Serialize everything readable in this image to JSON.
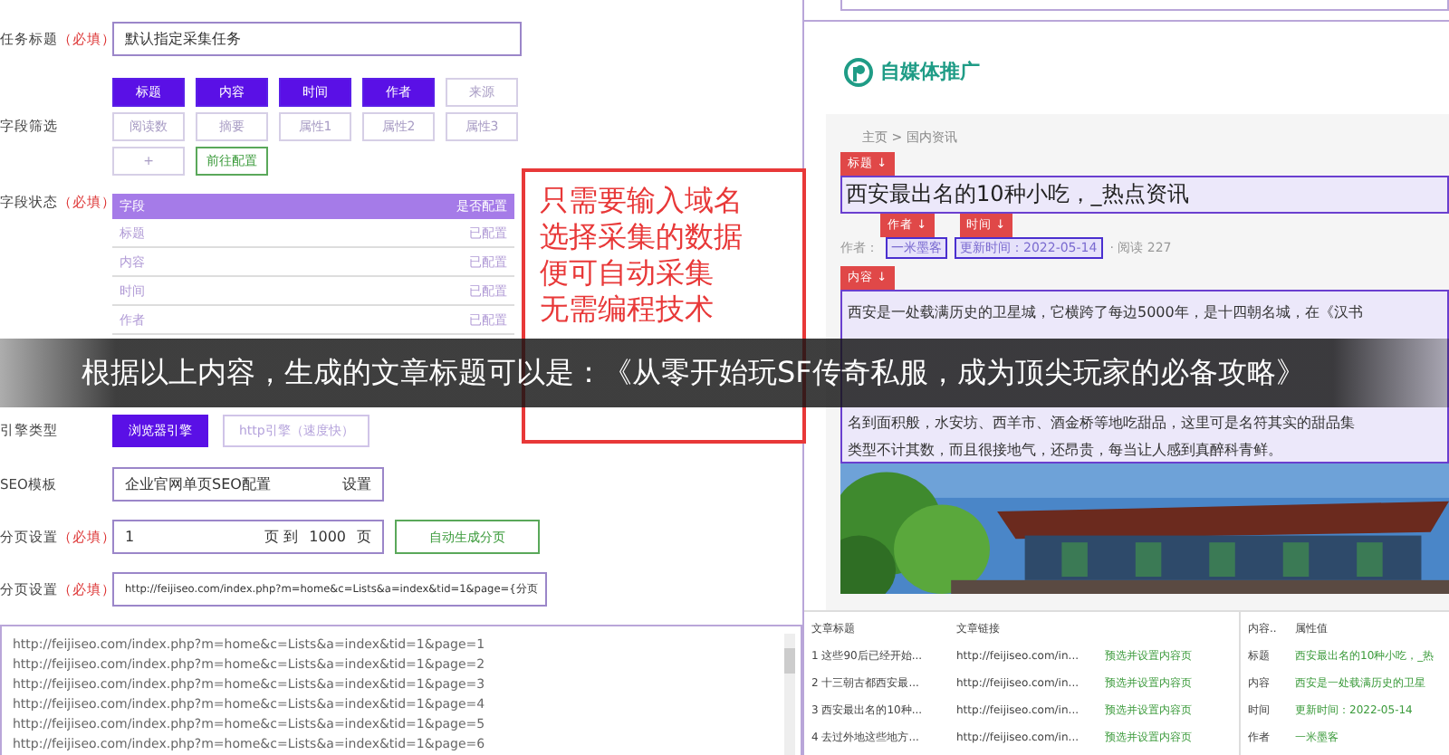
{
  "task": {
    "label": "任务标题",
    "required": "（必填）",
    "value": "默认指定采集任务"
  },
  "fields": {
    "label": "字段筛选",
    "options": [
      {
        "label": "标题",
        "selected": true
      },
      {
        "label": "内容",
        "selected": true
      },
      {
        "label": "时间",
        "selected": true
      },
      {
        "label": "作者",
        "selected": true
      },
      {
        "label": "来源",
        "selected": false
      },
      {
        "label": "阅读数",
        "selected": false
      },
      {
        "label": "摘要",
        "selected": false
      },
      {
        "label": "属性1",
        "selected": false
      },
      {
        "label": "属性2",
        "selected": false
      },
      {
        "label": "属性3",
        "selected": false
      }
    ],
    "add": "+",
    "configure": "前往配置"
  },
  "field_status": {
    "label": "字段状态",
    "required": "（必填）",
    "columns": [
      "字段",
      "是否配置"
    ],
    "rows": [
      {
        "field": "标题",
        "status": "已配置"
      },
      {
        "field": "内容",
        "status": "已配置"
      },
      {
        "field": "时间",
        "status": "已配置"
      },
      {
        "field": "作者",
        "status": "已配置"
      }
    ]
  },
  "engine": {
    "label": "引擎类型",
    "options": [
      {
        "label": "浏览器引擎",
        "selected": true
      },
      {
        "label": "http引擎（速度快）",
        "selected": false
      }
    ]
  },
  "seo": {
    "label": "SEO模板",
    "value": "企业官网单页SEO配置",
    "action": "设置"
  },
  "pagination": {
    "label": "分页设置",
    "required": "（必填）",
    "from": "1",
    "unit_from": "页 到",
    "to": "1000",
    "unit_to": "页",
    "generate": "自动生成分页"
  },
  "pagination_url": {
    "label": "分页设置",
    "required": "（必填）",
    "value": "http://feijiseo.com/index.php?m=home&c=Lists&a=index&tid=1&page={分页"
  },
  "url_list": [
    "http://feijiseo.com/index.php?m=home&c=Lists&a=index&tid=1&page=1",
    "http://feijiseo.com/index.php?m=home&c=Lists&a=index&tid=1&page=2",
    "http://feijiseo.com/index.php?m=home&c=Lists&a=index&tid=1&page=3",
    "http://feijiseo.com/index.php?m=home&c=Lists&a=index&tid=1&page=4",
    "http://feijiseo.com/index.php?m=home&c=Lists&a=index&tid=1&page=5",
    "http://feijiseo.com/index.php?m=home&c=Lists&a=index&tid=1&page=6"
  ],
  "annotation": {
    "lines": [
      "只需要输入域名",
      "选择采集的数据",
      "便可自动采集",
      "无需编程技术"
    ]
  },
  "preview": {
    "logo": "自媒体推广",
    "breadcrumb": "主页 > 国内资讯",
    "title_tag": "标题 ↓",
    "title": "西安最出名的10种小吃，_热点资讯",
    "author_tag": "作者 ↓",
    "time_tag": "时间 ↓",
    "author_label": "作者：",
    "author": "一米墨客",
    "time": "更新时间：2022-05-14",
    "reads": "· 阅读 227",
    "content_tag": "内容 ↓",
    "paragraphs": [
      "西安是一处载满历史的卫星城，它横跨了每边5000年，是十四朝名城，在《汉书",
      "名到面积般，水安坊、西羊市、酒金桥等地吃甜品，这里可是名符其实的甜品集",
      "类型不计其数，而且很接地气，还昂贵，每当让人感到真醉科青鲜。"
    ],
    "picture": {
      "kind": "picture"
    }
  },
  "articles": {
    "columns": [
      "文章标题",
      "文章链接"
    ],
    "rows": [
      {
        "title": "1 这些90后已经开始...",
        "link": "http://feijiseo.com/in...",
        "action": "预选并设置内容页"
      },
      {
        "title": "2 十三朝古都西安最...",
        "link": "http://feijiseo.com/in...",
        "action": "预选并设置内容页"
      },
      {
        "title": "3 西安最出名的10种...",
        "link": "http://feijiseo.com/in...",
        "action": "预选并设置内容页"
      },
      {
        "title": "4 去过外地这些地方...",
        "link": "http://feijiseo.com/in...",
        "action": "预选并设置内容页"
      }
    ]
  },
  "attributes": {
    "columns": [
      "内容..",
      "属性值"
    ],
    "rows": [
      {
        "name": "标题",
        "value": "西安最出名的10种小吃，_热"
      },
      {
        "name": "内容",
        "value": "西安是一处载满历史的卫星"
      },
      {
        "name": "时间",
        "value": "更新时间：2022-05-14"
      },
      {
        "name": "作者",
        "value": "一米墨客"
      }
    ]
  },
  "caption": "根据以上内容，生成的文章标题可以是：《从零开始玩SF传奇私服，成为顶尖玩家的必备攻略》"
}
